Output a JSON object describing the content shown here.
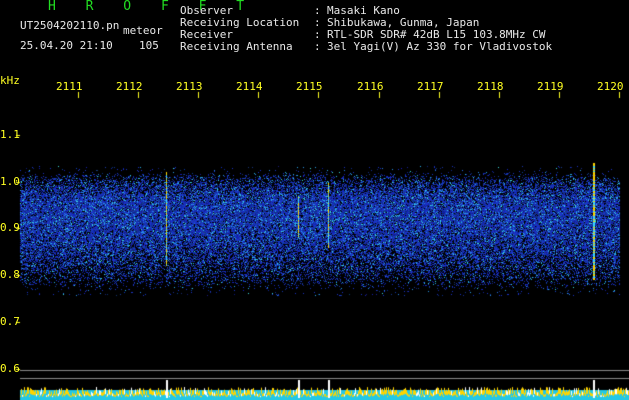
{
  "header": {
    "software": "H R O F F T",
    "filename": "UT2504202110.pn",
    "tag": "meteor",
    "datetime": "25.04.20 21:10",
    "count": "105",
    "fields": [
      {
        "label": "Observer",
        "value": "Masaki Kano"
      },
      {
        "label": "Receiving Location",
        "value": "Shibukawa, Gunma, Japan"
      },
      {
        "label": "Receiver",
        "value": "RTL-SDR SDR# 42dB L15 103.8MHz CW"
      },
      {
        "label": "Receiving Antenna",
        "value": "3el Yagi(V) Az 330 for Vladivostok"
      }
    ],
    "separator": ":"
  },
  "colors": {
    "background": "#000000",
    "text": "#e8e8e8",
    "axis": "#ffff22",
    "title": "#22dd22",
    "signal": "#1c34c8",
    "echo": "#ffd400",
    "baseline": "#23c8e6"
  },
  "chart_data": {
    "type": "heatmap",
    "title": "",
    "ylabel": "kHz",
    "y_ticks": [
      "1.1",
      "1.0",
      "0.9",
      "0.8",
      "0.7",
      "0.6"
    ],
    "ylim": [
      0.58,
      1.17
    ],
    "x_ticks": [
      "2111",
      "2112",
      "2113",
      "2114",
      "2115",
      "2116",
      "2117",
      "2118",
      "2119",
      "2120"
    ],
    "noise_band_khz": [
      0.77,
      1.02
    ],
    "signal_center_khz": 0.94,
    "events": [
      {
        "time": "2112.6",
        "freq_from": 0.82,
        "freq_to": 1.02
      },
      {
        "time": "2114.8",
        "freq_from": 0.88,
        "freq_to": 0.97
      },
      {
        "time": "2115.3",
        "freq_from": 0.86,
        "freq_to": 1.0
      },
      {
        "time": "2119.7",
        "freq_from": 0.79,
        "freq_to": 1.04
      }
    ]
  }
}
